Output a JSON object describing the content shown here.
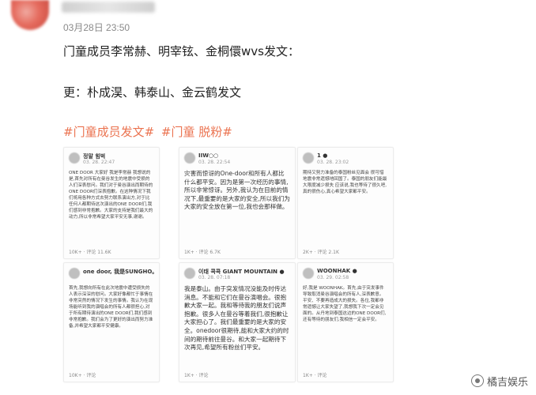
{
  "post": {
    "timestamp": "03月28日 23:50",
    "line1": "门童成员李常赫、明宰铉、金桐儇wvs发文：",
    "line2": "更：朴成淏、韩泰山、金云鹤发文",
    "hashtags": [
      "#门童成员发文#",
      "#门童 脱粉#"
    ]
  },
  "images": [
    {
      "name": "정말 힘벅",
      "date": "03. 28. 22:47",
      "body": "ONE DOOR 大家好 我是李常赫 我想说的是,首先对所有在曼谷发生的地震中受损的人们深表慰问。我们对于曼谷演出而期待的ONE DOOR们深表抱歉。在这种情况下我们将用各种方式去努力联系演出方,对于比任何人都期待这次演出的ONE DOOR们,我们感到非常抱歉。大家的支持是我们最大的动力,所以非常希望大家平安无事,谢谢。",
      "footer": "10K+ · 评论 11.6K"
    },
    {
      "name": "IIW○○",
      "date": "03. 28. 22:54",
      "body": "灾害而惊讶的One-door和所有人都比什么都平安。因为是第一次经历的事情,所以非常惊讶。另外,我认为在目前的情况下,最重要的是大家的安全,所以我们为大家的安全放在第一位,我也会那样做。",
      "footer": "1K+ · 评论 6.7K"
    },
    {
      "name": "1 ●",
      "date": "03. 28. 23:02",
      "body": "期待又努力准备的泰国粉丝见面会 很可惜地震非常遗憾地回国了。泰国的朋友们能最大限度减少损失 应该说,我也等待了很久吧,真的很伤心,真心希望大家都平安。",
      "footer": "2K+ · 评论 2.1K"
    },
    {
      "name": "one door, 我是SUNGHO。",
      "date": "",
      "body": "首先,我想向所有在此次地震中遭受损失的人表示深深的慰问。大家好像都忙于事情在非常突然的情况下发生的事情。我认为在现场能听到我的演唱会的所有人都很担心,对于所有期待演出的ONE DOOR们,我们感到非常抱歉。我们会为了更好的演出而努力准备,并希望大家都平安健康。",
      "footer": "10K+ · 评论"
    },
    {
      "name": "이태 콕콕 GIANT MOUNTAIN ●",
      "date": "03. 28. 07:18",
      "body": "我是泰山。由于突发情况没能及时传达消息。不能和它们在曼谷演唱会。很抱歉大家一起。我和等待我的朋友们说声抱歉。很多人在曼谷等着我们,很抱歉让大家担心了。我们最重要的是大家的安全。onedoor很期待,能和大家大约的时间的期待前往曼谷。和大家一起期待下次再见,希望所有粉丝们平安。",
      "footer": "1K+ · 评论"
    },
    {
      "name": "WOONHAK ●",
      "date": "03. 29. 02:58",
      "body": "好,我是 WOONHAK。首先,由于突发事件导致取消曼谷演唱会的所有人,深表歉意。平安、不要再造成大的损失。各位,我都非常遗憾让大家失望了,我想我下次一定会见面的。从丹地到泰国这边的ONE DOOR们,还有等待的朋友们,我相信一定会平安。",
      "footer": "1K+ · 评论"
    }
  ],
  "watermark": "橘吉娱乐"
}
